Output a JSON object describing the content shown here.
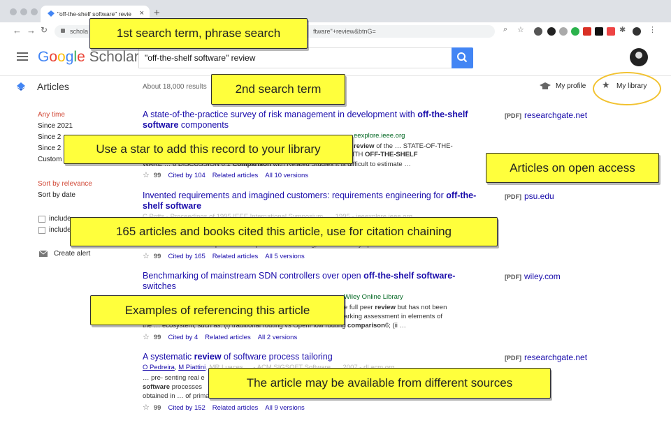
{
  "browser": {
    "tab_title": "\"off-the-shelf software\" revie",
    "tab_close": "×",
    "new_tab": "+",
    "url_prefix": "schola",
    "url_suffix": "ftware\"+review&btnG="
  },
  "header": {
    "logo_google": "Google",
    "logo_scholar": " Scholar",
    "search_query": "\"off-the-shelf software\" review"
  },
  "subheader": {
    "section_title": "Articles",
    "results_count": "About 18,000 results",
    "my_profile": "My profile",
    "my_library": "My library"
  },
  "sidebar": {
    "time_heading": "Any time",
    "since_2021": "Since 2021",
    "since_2": "Since 2",
    "since_3": "Since 2",
    "custom": "Custom",
    "sort_relevance": "Sort by relevance",
    "sort_date": "Sort by date",
    "include1": "include",
    "include2": "include",
    "create_alert": "Create alert"
  },
  "results": [
    {
      "title_plain": "A state-of-the-practice survey of risk management in development with ",
      "title_bold": "off-the-shelf software",
      "title_tail": " components",
      "meta": "eexplore.ieee.org",
      "snip1_pre": "",
      "snip1_bold": "review",
      "snip1_post": " of the … STATE-OF-THE-",
      "snip2_pre": "NT WITH ",
      "snip2_bold": "OFF-THE-SHELF",
      "snip3_pre": "WARE … 6 DISCUSSION 6.1 ",
      "snip3_bold": "Comparison",
      "snip3_post": " with Related Studies It is difficult to estimate …",
      "cited": "Cited by 104",
      "related": "Related articles",
      "versions": "All 10 versions",
      "pdf_tag": "[PDF]",
      "pdf_source": "researchgate.net"
    },
    {
      "title_plain": "Invented requirements and imagined customers: requirements engineering for ",
      "title_bold": "off-the-shelf software",
      "meta": "C Potts - Proceedings of 1995 IEEE International Symposium …, 1995 - ieeexplore.ieee.org",
      "snip_tail": "… state of practice in requirements modeling, 1408. IEEE Symp …",
      "cited": "Cited by 165",
      "related": "Related articles",
      "versions": "All 5 versions",
      "pdf_tag": "[PDF]",
      "pdf_source": "psu.edu"
    },
    {
      "title_plain": "Benchmarking of mainstream SDN controllers over open ",
      "title_bold": "off-the-shelf software-",
      "title_line2": "switches",
      "meta": "- Wiley Online Library",
      "snip1": "e full peer ",
      "snip1_bold": "review",
      "snip1_post": " but has not been",
      "snip2": "arking assessment in elements of",
      "snip3_pre": "the … ecosystem, such as: (i) traditional routing vs OpenFlow routing ",
      "snip3_bold": "comparison",
      "snip3_post": "6; (ii …",
      "cited": "Cited by 4",
      "related": "Related articles",
      "versions": "All 2 versions",
      "pdf_tag": "[PDF]",
      "pdf_source": "wiley.com"
    },
    {
      "title_plain": "A systematic ",
      "title_bold": "review",
      "title_tail": " of software process tailoring",
      "meta_auth1": "O Pedreira",
      "meta_auth2": "M Piattini",
      "meta_rest": ", MR Luaces … - ACM SIGSOFT Software …, 2007 - dl.acm.org",
      "snip1": "… pre- senting real e",
      "snip2_bold": "software",
      "snip2": " processes",
      "snip3": "obtained in … of prima",
      "cited": "Cited by 152",
      "related": "Related articles",
      "versions": "All 9 versions",
      "pdf_tag": "[PDF]",
      "pdf_source": "researchgate.net"
    }
  ],
  "callouts": {
    "c1": "1st search term, phrase search",
    "c2": "2nd search term",
    "c3": "Use a star to add this record to your library",
    "c4": "Articles on open access",
    "c5": "165 articles and books cited this article, use for citation chaining",
    "c6": "Examples of referencing this article",
    "c7": "The article may be available from different sources"
  }
}
